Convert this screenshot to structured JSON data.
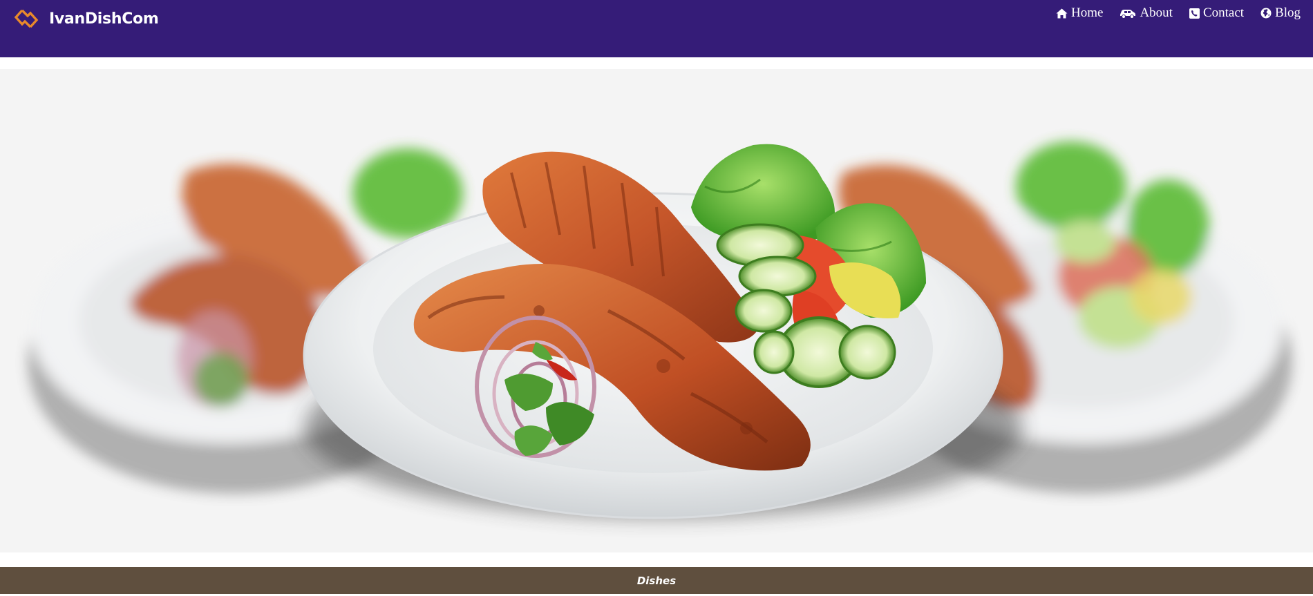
{
  "brand": {
    "name": "IvanDishCom",
    "logo_icon": "diamond-link-logo-icon",
    "logo_color": "#e8892b"
  },
  "nav": {
    "items": [
      {
        "label": "Home",
        "icon": "home-icon"
      },
      {
        "label": "About",
        "icon": "about-car-icon"
      },
      {
        "label": "Contact",
        "icon": "phone-icon"
      },
      {
        "label": "Blog",
        "icon": "globe-icon"
      }
    ]
  },
  "hero": {
    "image": "tandoori-chicken-plate-with-salad",
    "alt": ""
  },
  "section": {
    "title": "Dishes"
  },
  "colors": {
    "navbar": "#351c78",
    "section_bar": "#5f4f3e",
    "hero_background": "#f4f4f4",
    "text": "#ffffff"
  }
}
